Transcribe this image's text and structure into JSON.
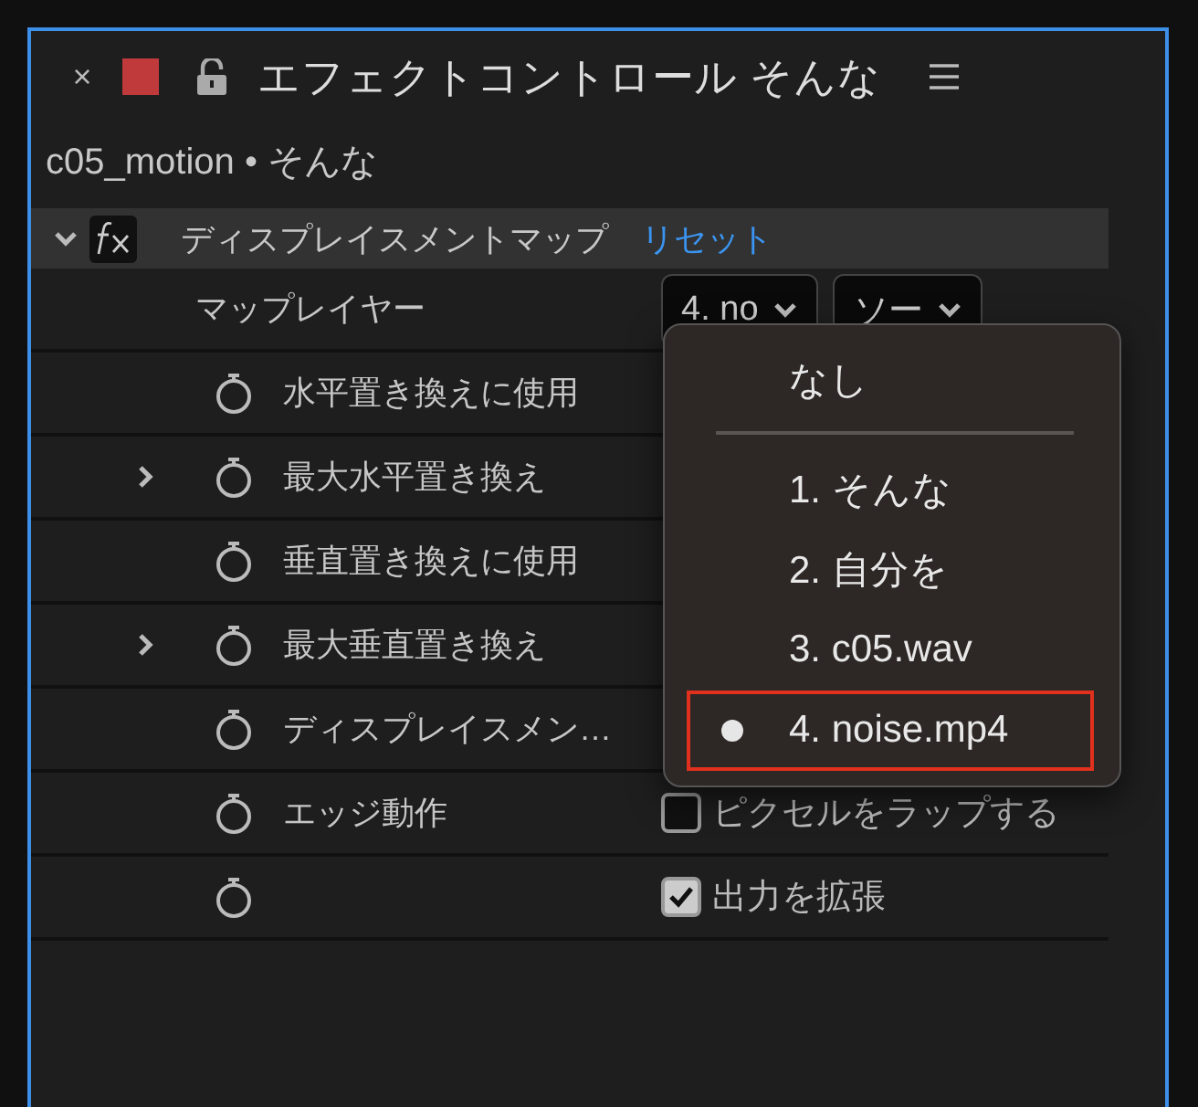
{
  "panel": {
    "close": "×",
    "title": "エフェクトコントロール そんな",
    "subtitle": "c05_motion • そんな"
  },
  "effect": {
    "name": "ディスプレイスメントマップ",
    "reset": "リセット",
    "expanded": true
  },
  "properties": [
    {
      "kind": "dropdowns",
      "label": "マップレイヤー",
      "twirl": false,
      "stopwatch": false,
      "dropdowns": [
        "4. no",
        "ソー"
      ]
    },
    {
      "kind": "plain",
      "label": "水平置き換えに使用",
      "twirl": false,
      "stopwatch": true
    },
    {
      "kind": "plain",
      "label": "最大水平置き換え",
      "twirl": true,
      "stopwatch": true
    },
    {
      "kind": "plain",
      "label": "垂直置き換えに使用",
      "twirl": false,
      "stopwatch": true
    },
    {
      "kind": "plain",
      "label": "最大垂直置き換え",
      "twirl": true,
      "stopwatch": true
    },
    {
      "kind": "plain",
      "label": "ディスプレイスメン…",
      "twirl": false,
      "stopwatch": true
    },
    {
      "kind": "checkbox",
      "label": "エッジ動作",
      "twirl": false,
      "stopwatch": true,
      "option": "ピクセルをラップする",
      "checked": false
    },
    {
      "kind": "checkbox",
      "twirl": false,
      "stopwatch": true,
      "option": "出力を拡張",
      "checked": true
    }
  ],
  "menu": {
    "items": [
      {
        "kind": "item",
        "label": "なし",
        "selected": false,
        "highlighted": false
      },
      {
        "kind": "divider"
      },
      {
        "kind": "item",
        "label": "1. そんな",
        "selected": false,
        "highlighted": false
      },
      {
        "kind": "item",
        "label": "2. 自分を",
        "selected": false,
        "highlighted": false
      },
      {
        "kind": "item",
        "label": "3. c05.wav",
        "selected": false,
        "highlighted": false
      },
      {
        "kind": "item",
        "label": "4. noise.mp4",
        "selected": true,
        "highlighted": true
      }
    ]
  }
}
